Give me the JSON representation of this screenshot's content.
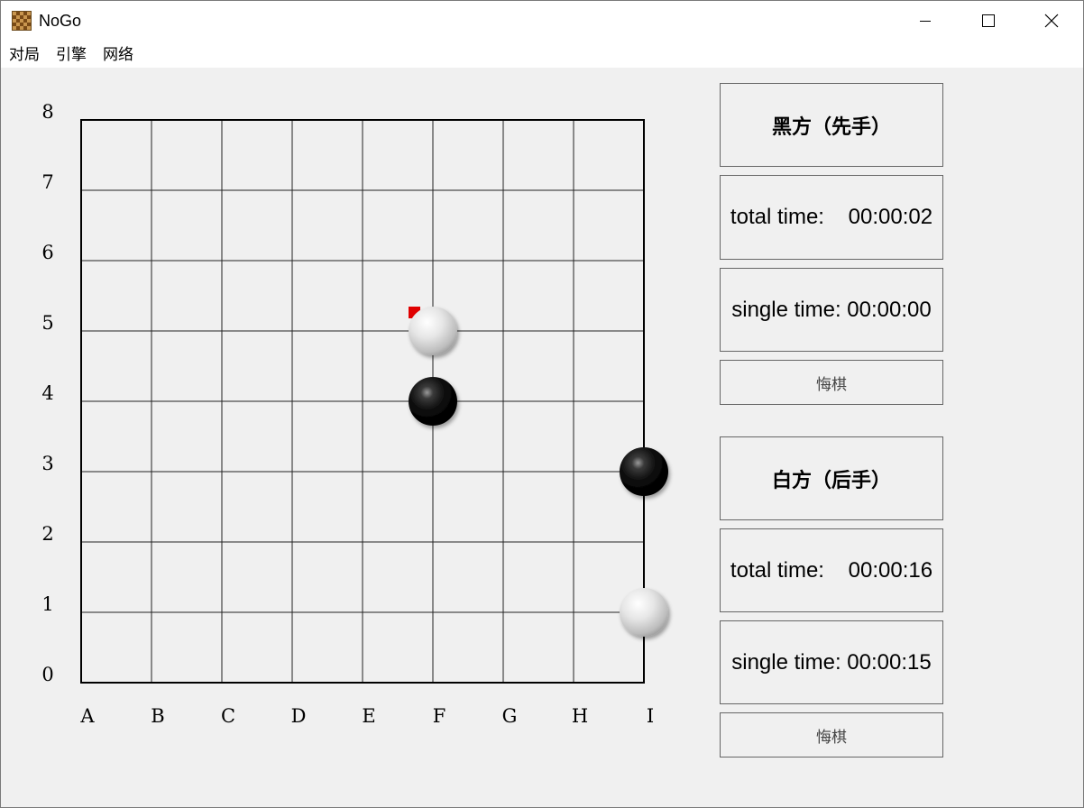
{
  "window": {
    "title": "NoGo",
    "app_icon": "board-icon",
    "controls": [
      "minimize-icon",
      "maximize-icon",
      "close-icon"
    ]
  },
  "menu": {
    "items": [
      {
        "label": "对局"
      },
      {
        "label": "引擎"
      },
      {
        "label": "网络"
      }
    ]
  },
  "board": {
    "columns": [
      "A",
      "B",
      "C",
      "D",
      "E",
      "F",
      "G",
      "H",
      "I"
    ],
    "rows": [
      "8",
      "7",
      "6",
      "5",
      "4",
      "3",
      "2",
      "1",
      "0"
    ],
    "stones": [
      {
        "color": "white",
        "point": "F5",
        "last_move": true
      },
      {
        "color": "black",
        "point": "F4",
        "last_move": false
      },
      {
        "color": "black",
        "point": "I3",
        "last_move": false
      },
      {
        "color": "white",
        "point": "I1",
        "last_move": false
      }
    ],
    "colors": {
      "line": "#222222",
      "last_move_marker": "#e00000"
    }
  },
  "black": {
    "title": "黑方（先手）",
    "total_time": "total time:    00:00:02",
    "single_time": "single time: 00:00:00",
    "undo": "悔棋"
  },
  "white": {
    "title": "白方（后手）",
    "total_time": "total time:    00:00:16",
    "single_time": "single time: 00:00:15",
    "undo": "悔棋"
  }
}
